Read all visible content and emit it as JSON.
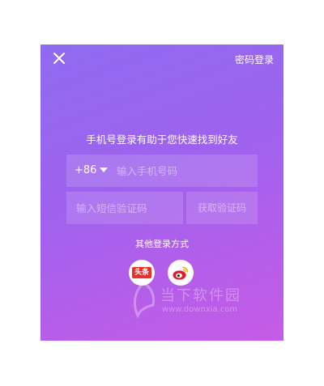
{
  "header": {
    "close_icon": "close-icon",
    "password_login_label": "密码登录"
  },
  "hint": "手机号登录有助于您快速找到好友",
  "phone_field": {
    "country_code": "+86",
    "placeholder": "输入手机号码"
  },
  "code_field": {
    "placeholder": "输入短信验证码",
    "get_code_label": "获取验证码"
  },
  "other_login": {
    "title": "其他登录方式",
    "providers": [
      {
        "name": "toutiao",
        "label": "头条",
        "color": "#e8302a"
      },
      {
        "name": "weibo",
        "color": "#e6162d"
      }
    ]
  },
  "watermark": {
    "name": "当下软件园",
    "url": "www.downxia.com"
  },
  "colors": {
    "gradient_start": "#8e6bf0",
    "gradient_end": "#c65be6"
  }
}
